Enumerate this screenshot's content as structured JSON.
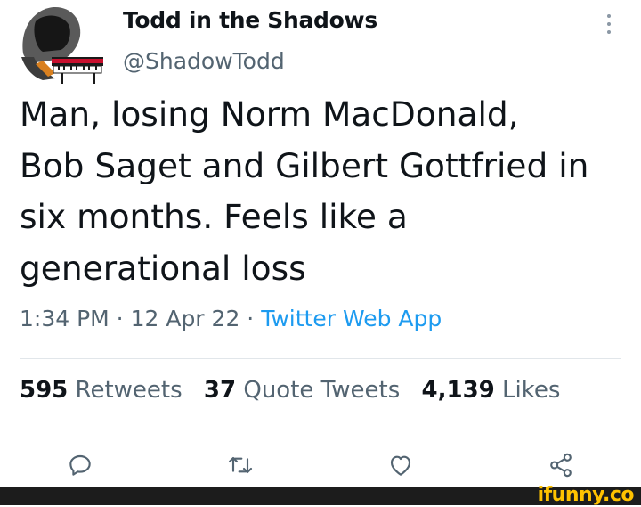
{
  "author": {
    "display_name": "Todd in the Shadows",
    "handle": "@ShadowTodd",
    "avatar_icon": "hooded-figure-piano-avatar"
  },
  "tweet": {
    "text": "Man, losing Norm MacDonald,\nBob Saget and Gilbert Gottfried in\nsix months. Feels like a\ngenerational loss",
    "time": "1:34 PM",
    "separator": " · ",
    "date": "12 Apr 22",
    "source": "Twitter Web App"
  },
  "stats": {
    "retweets_count": "595",
    "retweets_label": "Retweets",
    "quotes_count": "37",
    "quotes_label": "Quote Tweets",
    "likes_count": "4,139",
    "likes_label": "Likes"
  },
  "actions": [
    "reply-icon",
    "retweet-icon",
    "like-icon",
    "share-icon"
  ],
  "watermark": {
    "text": "ifunny.co"
  },
  "colors": {
    "text": "#0f1419",
    "secondary": "#536471",
    "link": "#1d9bf0",
    "icon": "#536471",
    "watermark": "#ffc200",
    "footer_bg": "#1c1c1c"
  }
}
